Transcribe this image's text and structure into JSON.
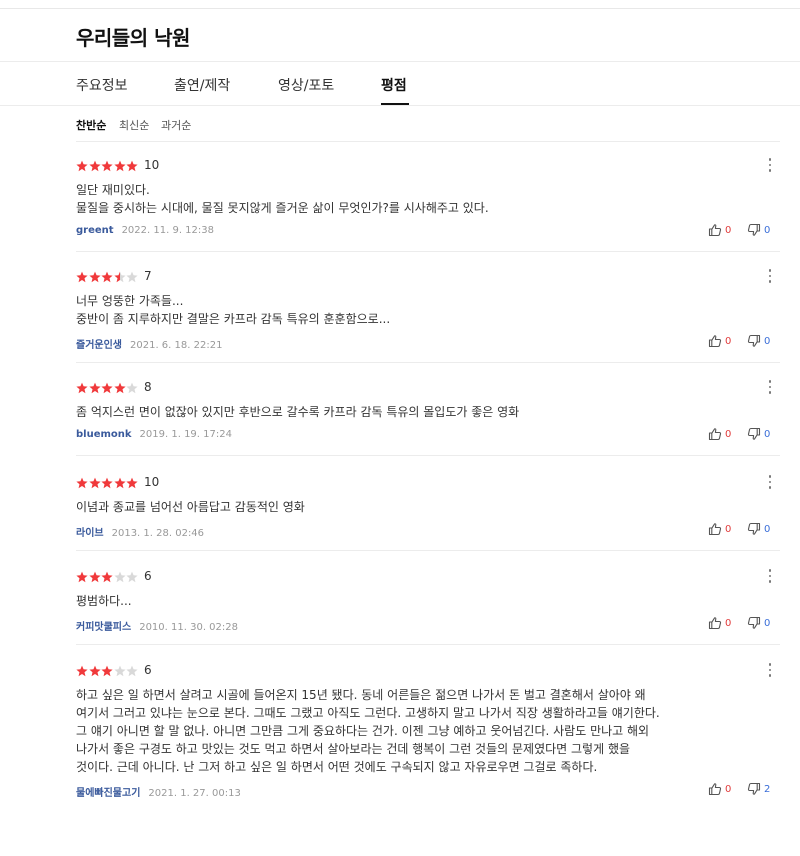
{
  "page": {
    "title": "우리들의 낙원"
  },
  "tabs": [
    {
      "label": "주요정보",
      "active": false
    },
    {
      "label": "출연/제작",
      "active": false
    },
    {
      "label": "영상/포토",
      "active": false
    },
    {
      "label": "평점",
      "active": true
    }
  ],
  "sort": [
    {
      "label": "찬반순",
      "active": true
    },
    {
      "label": "최신순",
      "active": false
    },
    {
      "label": "과거순",
      "active": false
    }
  ],
  "colors": {
    "star_on": "#f0393b",
    "star_off": "#d9d9d9",
    "like": "#e03b3b",
    "dislike": "#3a6ed8",
    "author": "#3a5a9c"
  },
  "icons": {
    "like": "thumbs-up-icon",
    "dislike": "thumbs-down-icon",
    "more": "more-vertical-icon"
  },
  "reviews": [
    {
      "stars": 5,
      "score": "10",
      "text": "일단 재미있다.\n물질을 중시하는 시대에, 물질 못지않게 즐거운 삶이  무엇인가?를 시사해주고 있다.",
      "author": "greent",
      "date": "2022. 11. 9. 12:38",
      "likes": "0",
      "dislikes": "0"
    },
    {
      "stars": 3.5,
      "score": "7",
      "text": "너무 엉뚱한 가족들...\n중반이 좀 지루하지만 결말은 카프라 감독 특유의 훈훈함으로...",
      "author": "즐거운인생",
      "date": "2021. 6. 18. 22:21",
      "likes": "0",
      "dislikes": "0"
    },
    {
      "stars": 4,
      "score": "8",
      "text": "좀 억지스런 면이 없잖아 있지만 후반으로 갈수록 카프라 감독 특유의  몰입도가 좋은 영화",
      "author": "bluemonk",
      "date": "2019. 1. 19. 17:24",
      "likes": "0",
      "dislikes": "0"
    },
    {
      "stars": 5,
      "score": "10",
      "text": "이념과 종교를 넘어선 아름답고 감동적인 영화",
      "author": "라이브",
      "date": "2013. 1. 28. 02:46",
      "likes": "0",
      "dislikes": "0"
    },
    {
      "stars": 3,
      "score": "6",
      "text": "평범하다...",
      "author": "커피맛쿨피스",
      "date": "2010. 11. 30. 02:28",
      "likes": "0",
      "dislikes": "0"
    },
    {
      "stars": 3,
      "score": "6",
      "text": "하고 싶은 일 하면서 살려고 시골에 들어온지 15년 됐다. 동네 어른들은 젊으면 나가서 돈 벌고 결혼해서 살아야 왜\n여기서 그러고 있냐는 눈으로 본다. 그때도 그랬고 아직도 그런다. 고생하지 말고 나가서 직장 생활하라고들 얘기한다.\n그 얘기 아니면 할 말 없나. 아니면 그만큼 그게 중요하다는 건가. 이젠 그냥 예하고 웃어넘긴다. 사람도 만나고 해외\n나가서 좋은 구경도 하고 맛있는 것도 먹고 하면서 살아보라는 건데 행복이 그런 것들의 문제였다면 그렇게 했을\n것이다. 근데 아니다. 난 그저 하고 싶은 일 하면서 어떤 것에도 구속되지 않고 자유로우면 그걸로 족하다.",
      "author": "물에빠진물고기",
      "date": "2021. 1. 27. 00:13",
      "likes": "0",
      "dislikes": "2"
    }
  ]
}
